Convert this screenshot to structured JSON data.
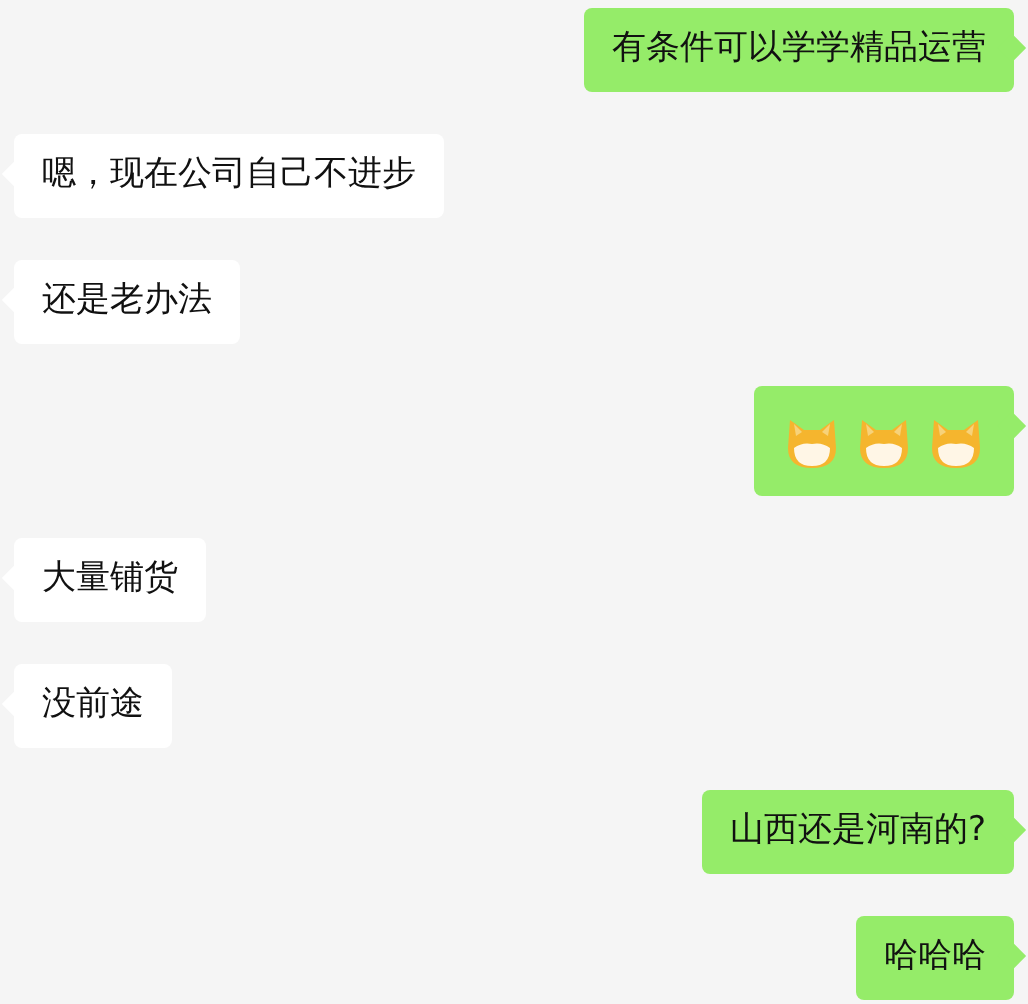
{
  "messages": [
    {
      "outgoing": true,
      "kind": "text",
      "text": "有条件可以学学精品运营"
    },
    {
      "outgoing": false,
      "kind": "text",
      "text": "嗯，现在公司自己不进步"
    },
    {
      "outgoing": false,
      "kind": "text",
      "text": "还是老办法"
    },
    {
      "outgoing": true,
      "kind": "stickers"
    },
    {
      "outgoing": false,
      "kind": "text",
      "text": "大量铺货"
    },
    {
      "outgoing": false,
      "kind": "text",
      "text": "没前途"
    },
    {
      "outgoing": true,
      "kind": "text",
      "text": "山西还是河南的?"
    },
    {
      "outgoing": true,
      "kind": "text",
      "text": "哈哈哈"
    }
  ]
}
